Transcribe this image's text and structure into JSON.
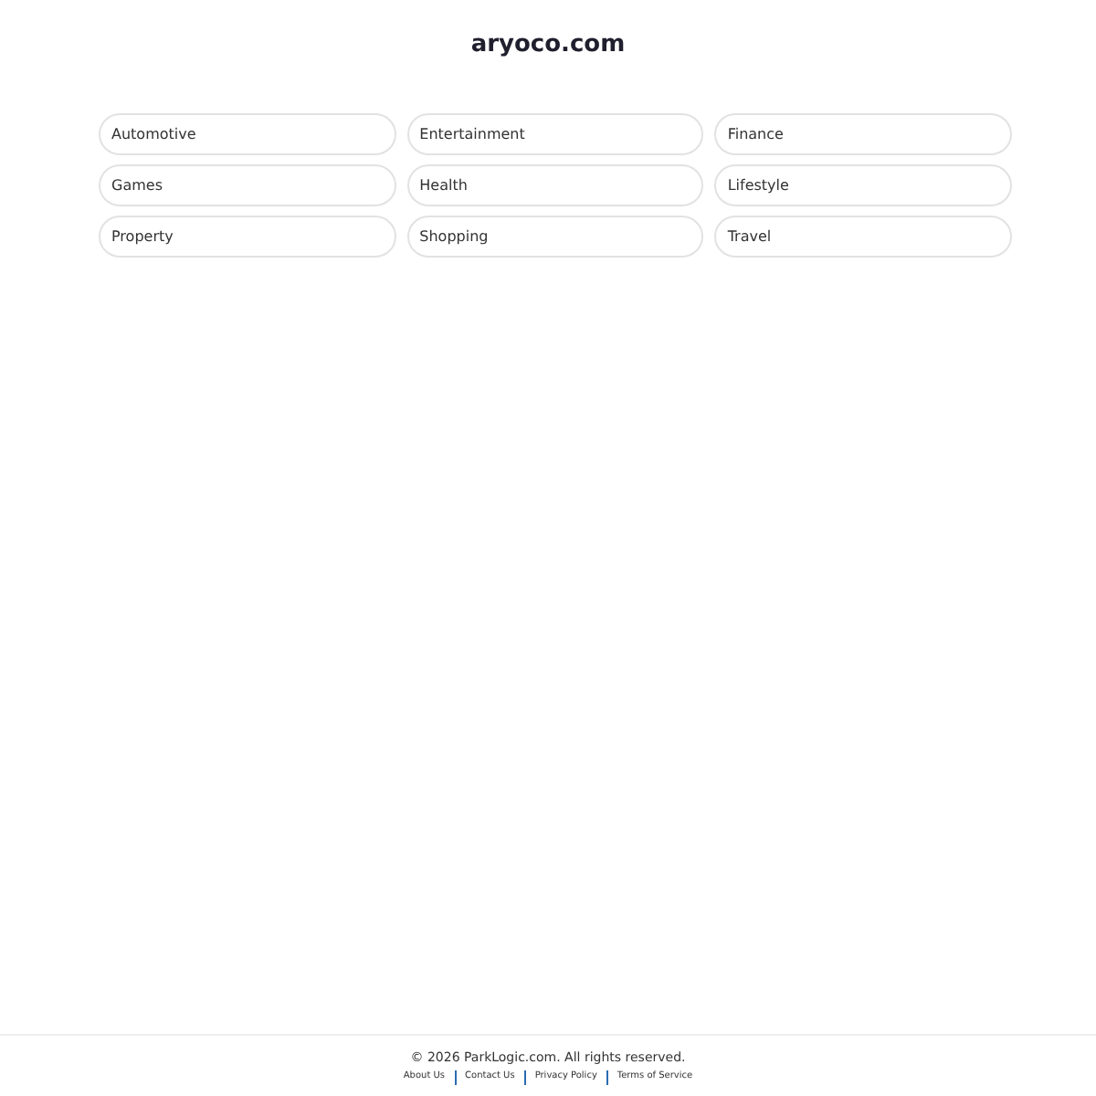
{
  "header": {
    "title": "aryoco.com"
  },
  "categories": [
    "Automotive",
    "Entertainment",
    "Finance",
    "Games",
    "Health",
    "Lifestyle",
    "Property",
    "Shopping",
    "Travel"
  ],
  "footer": {
    "copyright": "© 2026 ParkLogic.com. All rights reserved.",
    "links": [
      "About Us",
      "Contact Us",
      "Privacy Policy",
      "Terms of Service"
    ]
  }
}
